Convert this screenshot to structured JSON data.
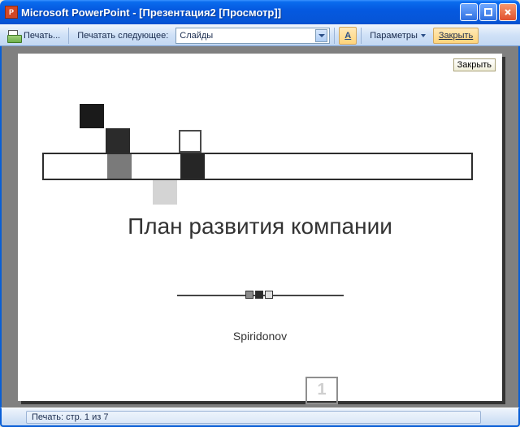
{
  "window": {
    "title": "Microsoft PowerPoint - [Презентация2 [Просмотр]]"
  },
  "toolbar": {
    "print_label": "Печать...",
    "print_what_label": "Печатать следующее:",
    "print_what_value": "Слайды",
    "frame_letter": "A",
    "options_label": "Параметры",
    "close_label": "Закрыть"
  },
  "slide": {
    "close_tip": "Закрыть",
    "title": "План развития компании",
    "author": "Spiridonov",
    "page_number": "1"
  },
  "status": {
    "text": "Печать: стр. 1 из 7"
  }
}
